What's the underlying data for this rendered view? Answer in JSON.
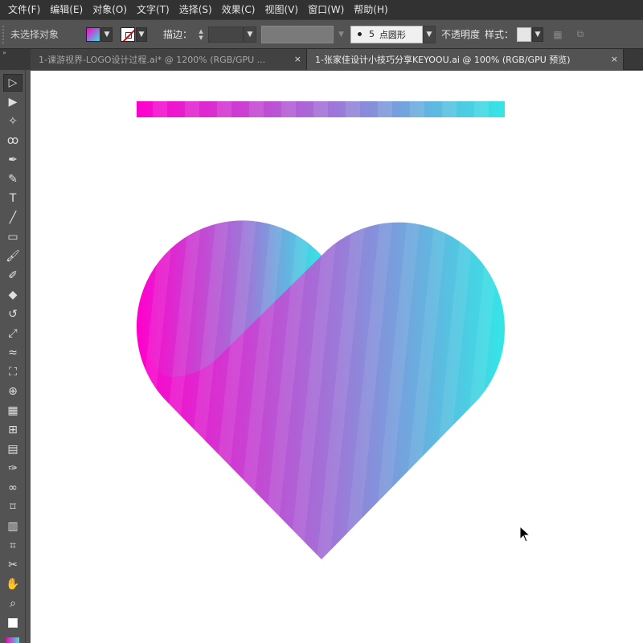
{
  "menu": {
    "items": [
      "文件(F)",
      "编辑(E)",
      "对象(O)",
      "文字(T)",
      "选择(S)",
      "效果(C)",
      "视图(V)",
      "窗口(W)",
      "帮助(H)"
    ]
  },
  "control_bar": {
    "selection_status": "未选择对象",
    "stroke_label": "描边：",
    "brush_value": "5",
    "brush_name": "点圆形",
    "opacity_label": "不透明度",
    "style_label": "样式："
  },
  "tabs": [
    {
      "label": "1-课游视界-LOGO设计过程.ai* @ 1200% (RGB/GPU ...",
      "active": false,
      "close": "×"
    },
    {
      "label": "1-张家佳设计小技巧分享KEYOOU.ai @ 100% (RGB/GPU 预览)",
      "active": true,
      "close": "×"
    }
  ],
  "toolbar": {
    "collapse_glyph": "»",
    "tools": [
      {
        "icon": "selection-tool-icon",
        "glyph": "▷",
        "active": true
      },
      {
        "icon": "direct-selection-tool-icon",
        "glyph": "▶"
      },
      {
        "icon": "magic-wand-tool-icon",
        "glyph": "✧"
      },
      {
        "icon": "lasso-tool-icon",
        "glyph": "ꝏ"
      },
      {
        "icon": "pen-tool-icon",
        "glyph": "✒"
      },
      {
        "icon": "curvature-tool-icon",
        "glyph": "✎"
      },
      {
        "icon": "type-tool-icon",
        "glyph": "T"
      },
      {
        "icon": "line-tool-icon",
        "glyph": "╱"
      },
      {
        "icon": "rectangle-tool-icon",
        "glyph": "▭"
      },
      {
        "icon": "paintbrush-tool-icon",
        "glyph": "🖌"
      },
      {
        "icon": "shaper-tool-icon",
        "glyph": "✐"
      },
      {
        "icon": "eraser-tool-icon",
        "glyph": "◆"
      },
      {
        "icon": "rotate-tool-icon",
        "glyph": "↺"
      },
      {
        "icon": "scale-tool-icon",
        "glyph": "⤢"
      },
      {
        "icon": "warp-tool-icon",
        "glyph": "≈"
      },
      {
        "icon": "free-transform-tool-icon",
        "glyph": "⛶"
      },
      {
        "icon": "shape-builder-tool-icon",
        "glyph": "⊕"
      },
      {
        "icon": "perspective-grid-tool-icon",
        "glyph": "▦"
      },
      {
        "icon": "mesh-tool-icon",
        "glyph": "⊞"
      },
      {
        "icon": "gradient-tool-icon",
        "glyph": "▤"
      },
      {
        "icon": "eyedropper-tool-icon",
        "glyph": "✑"
      },
      {
        "icon": "blend-tool-icon",
        "glyph": "∞"
      },
      {
        "icon": "symbol-sprayer-tool-icon",
        "glyph": "⌑"
      },
      {
        "icon": "column-graph-tool-icon",
        "glyph": "▥"
      },
      {
        "icon": "artboard-tool-icon",
        "glyph": "⌗"
      },
      {
        "icon": "slice-tool-icon",
        "glyph": "✂"
      },
      {
        "icon": "hand-tool-icon",
        "glyph": "✋"
      },
      {
        "icon": "zoom-tool-icon",
        "glyph": "⌕"
      }
    ]
  },
  "colors": {
    "gradient_start": "#ff00cc",
    "gradient_mid": "#9b7ad8",
    "gradient_end": "#33e6e6"
  }
}
